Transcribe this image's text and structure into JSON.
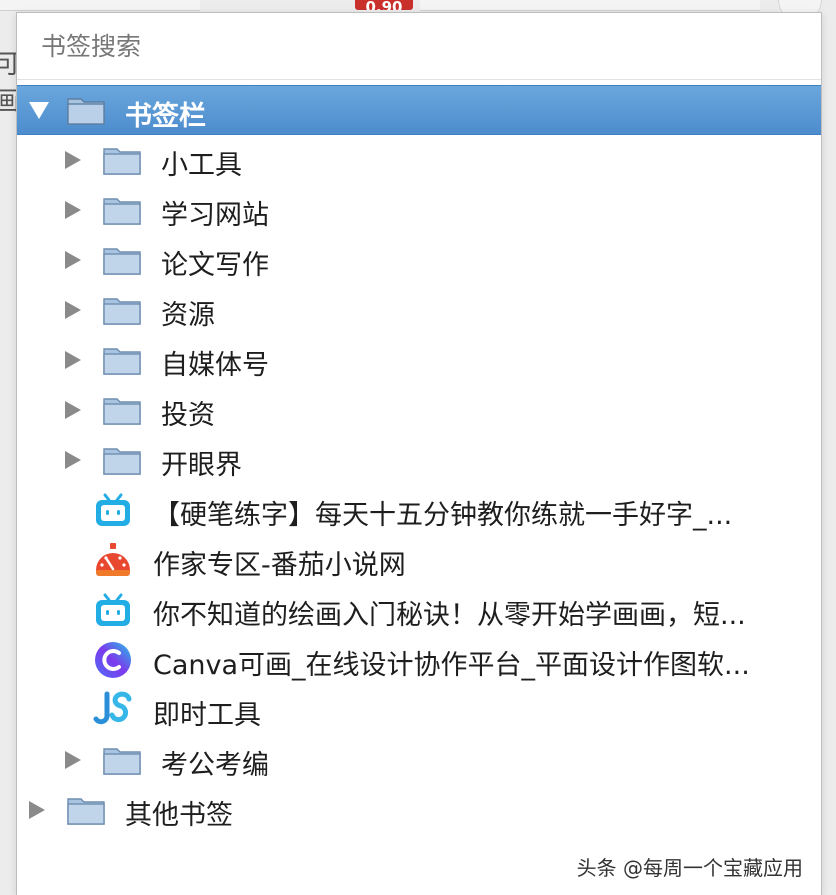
{
  "background": {
    "badge_text": "0.90",
    "edge_text": "可画"
  },
  "search": {
    "placeholder": "书签搜索"
  },
  "bookmarks_bar": {
    "label": "书签栏",
    "items": [
      {
        "type": "folder",
        "label": "小工具"
      },
      {
        "type": "folder",
        "label": "学习网站"
      },
      {
        "type": "folder",
        "label": "论文写作"
      },
      {
        "type": "folder",
        "label": "资源"
      },
      {
        "type": "folder",
        "label": "自媒体号"
      },
      {
        "type": "folder",
        "label": "投资"
      },
      {
        "type": "folder",
        "label": "开眼界"
      },
      {
        "type": "link",
        "icon": "bilibili-icon",
        "label": "【硬笔练字】每天十五分钟教你练就一手好字_..."
      },
      {
        "type": "link",
        "icon": "fanqie-icon",
        "label": "作家专区-番茄小说网"
      },
      {
        "type": "link",
        "icon": "bilibili-icon",
        "label": "你不知道的绘画入门秘诀！从零开始学画画，短..."
      },
      {
        "type": "link",
        "icon": "canva-icon",
        "label": "Canva可画_在线设计协作平台_平面设计作图软..."
      },
      {
        "type": "link",
        "icon": "js-tool-icon",
        "label": "即时工具"
      },
      {
        "type": "folder",
        "label": "考公考编"
      }
    ]
  },
  "other_bookmarks": {
    "label": "其他书签"
  },
  "watermark": "头条 @每周一个宝藏应用",
  "colors": {
    "selection": "#4d8ccd",
    "folder": "#9bb8d6",
    "bilibili": "#23ade5",
    "fanqie": "#e8482f",
    "canva": "#6b4fe0"
  }
}
